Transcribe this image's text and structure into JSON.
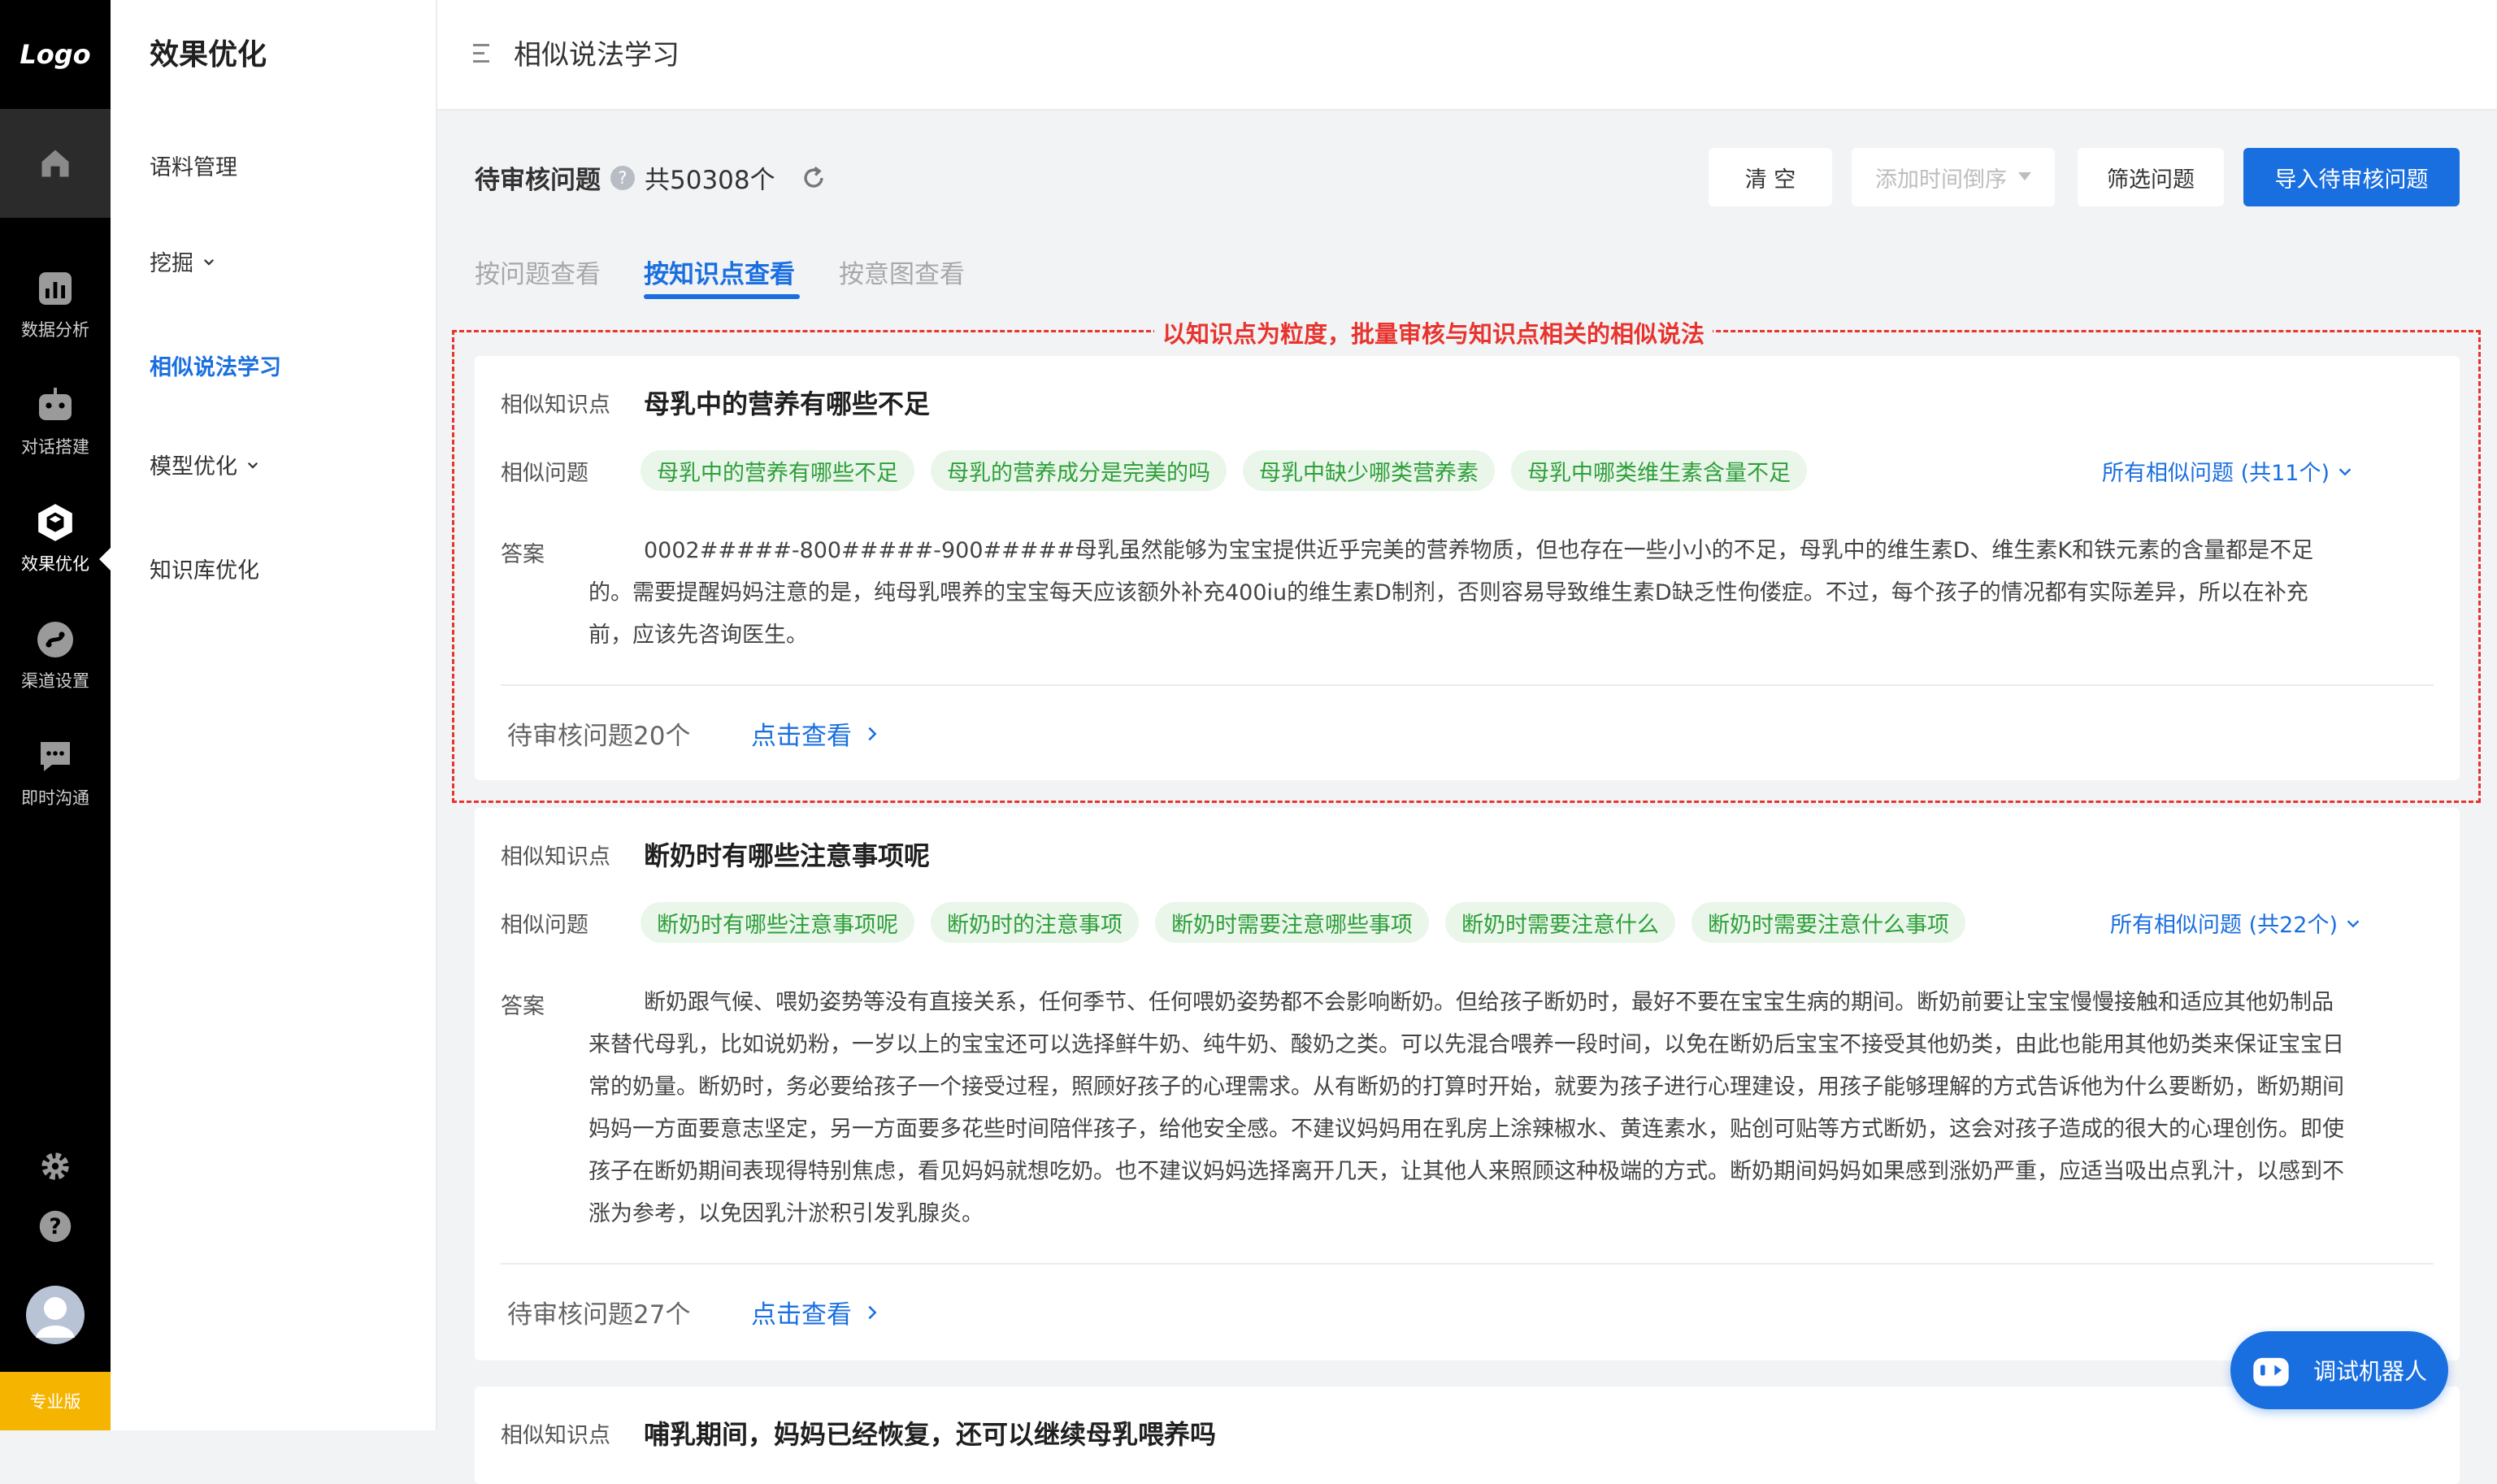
{
  "rail": {
    "logo": "Logo",
    "items": [
      {
        "label": "数据分析",
        "icon": "bar-chart-icon"
      },
      {
        "label": "对话搭建",
        "icon": "robot-icon"
      },
      {
        "label": "效果优化",
        "icon": "cube-icon"
      },
      {
        "label": "渠道设置",
        "icon": "channel-icon"
      },
      {
        "label": "即时沟通",
        "icon": "chat-icon"
      }
    ],
    "edition": "专业版"
  },
  "sidebar": {
    "title": "效果优化",
    "items": [
      {
        "label": "语料管理"
      },
      {
        "label": "挖掘"
      },
      {
        "label": "相似说法学习"
      },
      {
        "label": "模型优化"
      },
      {
        "label": "知识库优化"
      }
    ]
  },
  "header": {
    "page_title": "相似说法学习"
  },
  "toolbar": {
    "title": "待审核问题",
    "help": "?",
    "count": "共50308个",
    "clear": "清 空",
    "sort": "添加时间倒序",
    "filter": "筛选问题",
    "import": "导入待审核问题"
  },
  "tabs": [
    {
      "label": "按问题查看"
    },
    {
      "label": "按知识点查看"
    },
    {
      "label": "按意图查看"
    }
  ],
  "annotation": "以知识点为粒度，批量审核与知识点相关的相似说法",
  "labels": {
    "kp": "相似知识点",
    "sim": "相似问题",
    "ans": "答案",
    "view": "点击查看"
  },
  "cards": [
    {
      "kp": "母乳中的营养有哪些不足",
      "tags": [
        "母乳中的营养有哪些不足",
        "母乳的营养成分是完美的吗",
        "母乳中缺少哪类营养素",
        "母乳中哪类维生素含量不足"
      ],
      "all": "所有相似问题 (共11个)",
      "answer": "0002#####-800#####-900#####母乳虽然能够为宝宝提供近乎完美的营养物质，但也存在一些小小的不足，母乳中的维生素D、维生素K和铁元素的含量都是不足的。需要提醒妈妈注意的是，纯母乳喂养的宝宝每天应该额外补充400iu的维生素D制剂，否则容易导致维生素D缺乏性佝偻症。不过，每个孩子的情况都有实际差异，所以在补充前，应该先咨询医生。",
      "pending": "待审核问题20个"
    },
    {
      "kp": "断奶时有哪些注意事项呢",
      "tags": [
        "断奶时有哪些注意事项呢",
        "断奶时的注意事项",
        "断奶时需要注意哪些事项",
        "断奶时需要注意什么",
        "断奶时需要注意什么事项"
      ],
      "all": "所有相似问题 (共22个)",
      "answer": "断奶跟气候、喂奶姿势等没有直接关系，任何季节、任何喂奶姿势都不会影响断奶。但给孩子断奶时，最好不要在宝宝生病的期间。断奶前要让宝宝慢慢接触和适应其他奶制品来替代母乳，比如说奶粉，一岁以上的宝宝还可以选择鲜牛奶、纯牛奶、酸奶之类。可以先混合喂养一段时间，以免在断奶后宝宝不接受其他奶类，由此也能用其他奶类来保证宝宝日常的奶量。断奶时，务必要给孩子一个接受过程，照顾好孩子的心理需求。从有断奶的打算时开始，就要为孩子进行心理建设，用孩子能够理解的方式告诉他为什么要断奶，断奶期间妈妈一方面要意志坚定，另一方面要多花些时间陪伴孩子，给他安全感。不建议妈妈用在乳房上涂辣椒水、黄连素水，贴创可贴等方式断奶，这会对孩子造成的很大的心理创伤。即使孩子在断奶期间表现得特别焦虑，看见妈妈就想吃奶。也不建议妈妈选择离开几天，让其他人来照顾这种极端的方式。断奶期间妈妈如果感到涨奶严重，应适当吸出点乳汁，以感到不涨为参考，以免因乳汁淤积引发乳腺炎。",
      "pending": "待审核问题27个"
    },
    {
      "kp": "哺乳期间，妈妈已经恢复，还可以继续母乳喂养吗"
    }
  ],
  "bot_button": "调试机器人"
}
